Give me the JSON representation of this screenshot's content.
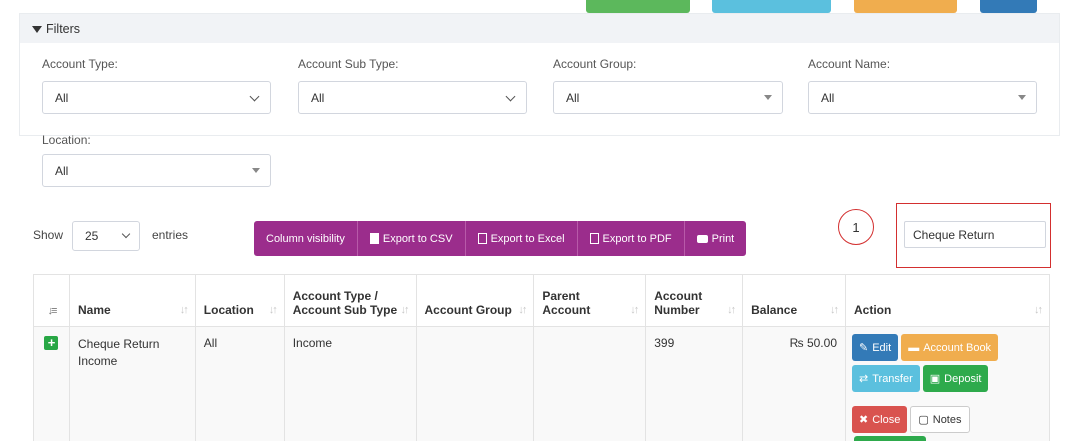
{
  "colors": {
    "top_green": "#5cb85c",
    "top_cyan": "#5bc0de",
    "top_orange": "#f0ad4e",
    "top_blue": "#337ab7",
    "export_purple": "#9b2d8c",
    "callout_red": "#d32f2f"
  },
  "filters": {
    "title": "Filters",
    "account_type": {
      "label": "Account Type:",
      "value": "All"
    },
    "account_sub_type": {
      "label": "Account Sub Type:",
      "value": "All"
    },
    "account_group": {
      "label": "Account Group:",
      "value": "All"
    },
    "account_name": {
      "label": "Account Name:",
      "value": "All"
    },
    "location": {
      "label": "Location:",
      "value": "All"
    }
  },
  "length": {
    "show": "Show",
    "value": "25",
    "entries": "entries"
  },
  "buttons": {
    "column_visibility": "Column visibility",
    "csv": "Export to CSV",
    "excel": "Export to Excel",
    "pdf": "Export to PDF",
    "print": "Print"
  },
  "callout": {
    "number": "1"
  },
  "search": {
    "value": "Cheque Return"
  },
  "table": {
    "headers": [
      "Name",
      "Location",
      "Account Type / Account Sub Type",
      "Account Group",
      "Parent Account",
      "Account Number",
      "Balance",
      "Action"
    ],
    "header_lines": {
      "acct_type_1": "Account Type /",
      "acct_type_2": "Account Sub Type",
      "parent_1": "Parent",
      "parent_2": "Account",
      "number_1": "Account",
      "number_2": "Number"
    },
    "row": {
      "name": "Cheque Return Income",
      "location": "All",
      "type": "Income",
      "group": "",
      "parent": "",
      "number": "399",
      "balance": "₨ 50.00"
    },
    "actions": {
      "edit": "Edit",
      "account_book": "Account Book",
      "transfer": "Transfer",
      "deposit": "Deposit",
      "close": "Close",
      "notes": "Notes"
    }
  }
}
